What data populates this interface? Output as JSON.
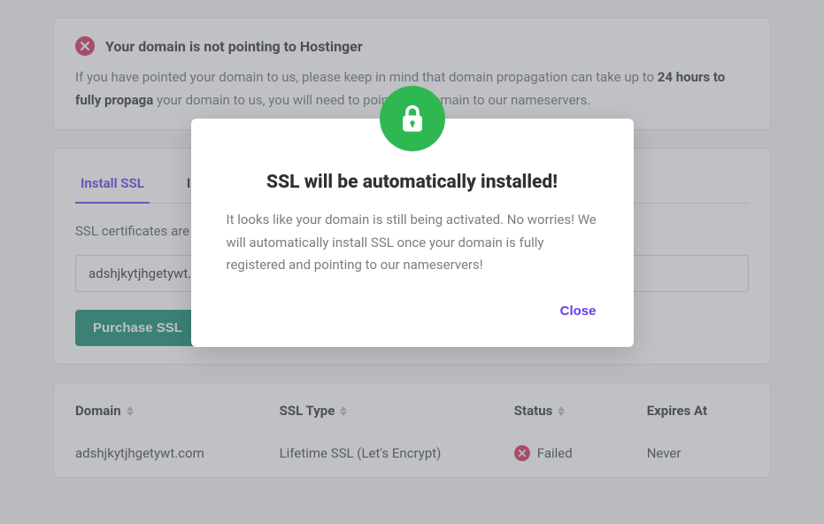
{
  "alert": {
    "title": "Your domain is not pointing to Hostinger",
    "body_part1": "If you have pointed your domain to us, please keep in mind that domain propagation can take up to ",
    "body_strong": "24 hours to fully propaga",
    "body_part2": "your domain to us, you will need to point your domain to our nameservers."
  },
  "tabs": {
    "install": "Install SSL",
    "second": "Im"
  },
  "ssl": {
    "description": "SSL certificates are a                                                                                                                                          n a web server and a browser.",
    "input_value": "adshjkytjhgetywt.c",
    "button": "Purchase SSL"
  },
  "table": {
    "headers": {
      "domain": "Domain",
      "ssl_type": "SSL Type",
      "status": "Status",
      "expires": "Expires At"
    },
    "row": {
      "domain": "adshjkytjhgetywt.com",
      "ssl_type": "Lifetime SSL (Let's Encrypt)",
      "status": "Failed",
      "expires": "Never"
    }
  },
  "modal": {
    "title": "SSL will be automatically installed!",
    "body": "It looks like your domain is still being activated. No worries! We will automatically install SSL once your domain is fully registered and pointing to our nameservers!",
    "close": "Close"
  }
}
